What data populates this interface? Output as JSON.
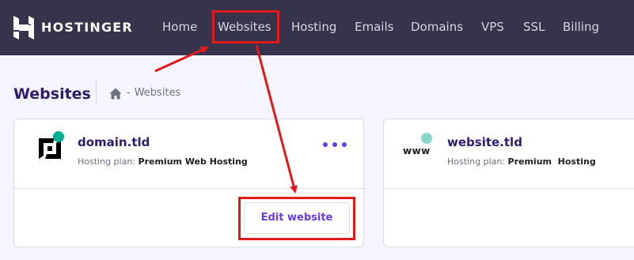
{
  "brand": {
    "name": "HOSTINGER"
  },
  "nav": {
    "items": [
      {
        "label": "Home"
      },
      {
        "label": "Websites"
      },
      {
        "label": "Hosting"
      },
      {
        "label": "Emails"
      },
      {
        "label": "Domains"
      },
      {
        "label": "VPS"
      },
      {
        "label": "SSL"
      },
      {
        "label": "Billing"
      }
    ]
  },
  "header": {
    "title": "Websites",
    "breadcrumb": {
      "icon": "home-icon",
      "separator": "-",
      "current": "Websites"
    }
  },
  "websites": [
    {
      "domain": "domain.tld",
      "plan_label": "Hosting plan:",
      "plan_value": "Premium Web Hosting",
      "icon": "site-logo-icon",
      "status_color": "#00b090",
      "action_label": "Edit website"
    },
    {
      "domain": "website.tld",
      "icon_text": "www",
      "plan_label": "Hosting plan:",
      "plan_value": "Premium  Hosting",
      "status_color": "#87d6c6"
    }
  ],
  "colors": {
    "topbar": "#36344d",
    "accent": "#673de6",
    "annotation": "#e01a1a",
    "background": "#f4f5ff"
  }
}
